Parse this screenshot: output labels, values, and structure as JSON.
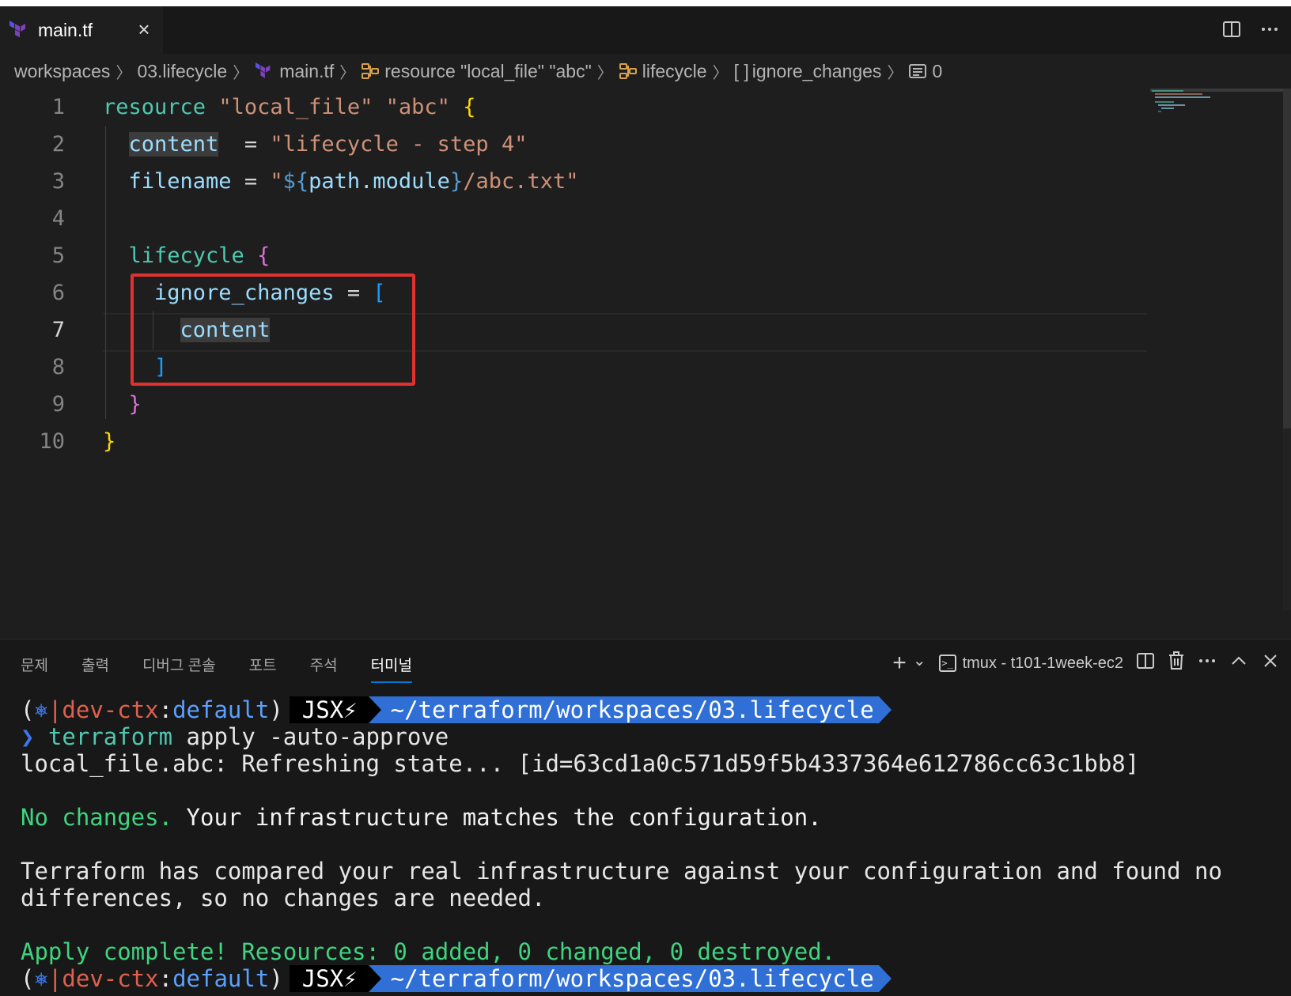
{
  "tab": {
    "filename": "main.tf",
    "close_glyph": "×"
  },
  "breadcrumb": {
    "items": [
      "workspaces",
      "03.lifecycle",
      "main.tf",
      "resource \"local_file\" \"abc\"",
      "lifecycle",
      "ignore_changes",
      "0"
    ],
    "array_glyph": "[ ]"
  },
  "editor": {
    "line_numbers": [
      "1",
      "2",
      "3",
      "4",
      "5",
      "6",
      "7",
      "8",
      "9",
      "10"
    ],
    "active_line": "7",
    "code": {
      "l1_kw": "resource",
      "l1_type": "\"local_file\"",
      "l1_name": "\"abc\"",
      "l1_brace": "{",
      "l2_attr": "content",
      "l2_eq": "  = ",
      "l2_val": "\"lifecycle - step 4\"",
      "l3_attr": "filename",
      "l3_eq": " = ",
      "l3_q1": "\"",
      "l3_interp_open": "${",
      "l3_interp_body": "path.module",
      "l3_interp_close": "}",
      "l3_rest": "/abc.txt\"",
      "l5_kw": "lifecycle",
      "l5_brace": "{",
      "l6_attr": "ignore_changes",
      "l6_eq": " = ",
      "l6_bracket": "[",
      "l7_value": "content",
      "l8_bracket": "]",
      "l9_brace": "}",
      "l10_brace": "}"
    }
  },
  "panel": {
    "tabs": [
      "문제",
      "출력",
      "디버그 콘솔",
      "포트",
      "주석",
      "터미널"
    ],
    "active_tab": "터미널",
    "terminal_name": "tmux - t101-1week-ec2",
    "add_glyph": "+",
    "chevron_glyph": "⌄"
  },
  "terminal": {
    "prompt": {
      "open": "(",
      "k8s_glyph": "⎈",
      "bar": "|",
      "ctx": "dev-ctx",
      "colon": ":",
      "ns": "default",
      "close": ")",
      "user": "JSX⚡",
      "path": "~/terraform/workspaces/03.lifecycle"
    },
    "cmd_arrow": "❯",
    "cmd_name": "terraform",
    "cmd_args": " apply -auto-approve",
    "refresh_line": "local_file.abc: Refreshing state... [id=63cd1a0c571d59f5b4337364e612786cc63c1bb8]",
    "no_changes_green": "No changes.",
    "no_changes_rest": " Your infrastructure matches the configuration.",
    "compared_line1": "Terraform has compared your real infrastructure against your configuration and found no",
    "compared_line2": "differences, so no changes are needed.",
    "apply_complete": "Apply complete! Resources: 0 added, 0 changed, 0 destroyed."
  },
  "colors": {
    "editor_bg": "#1e1e1e",
    "keyword": "#4ec9b0",
    "string": "#ce9178",
    "attribute": "#9cdcfe",
    "highlight_box": "#e0312e",
    "prompt_path_bg": "#2f6fd6",
    "success_green": "#3fd47f"
  }
}
